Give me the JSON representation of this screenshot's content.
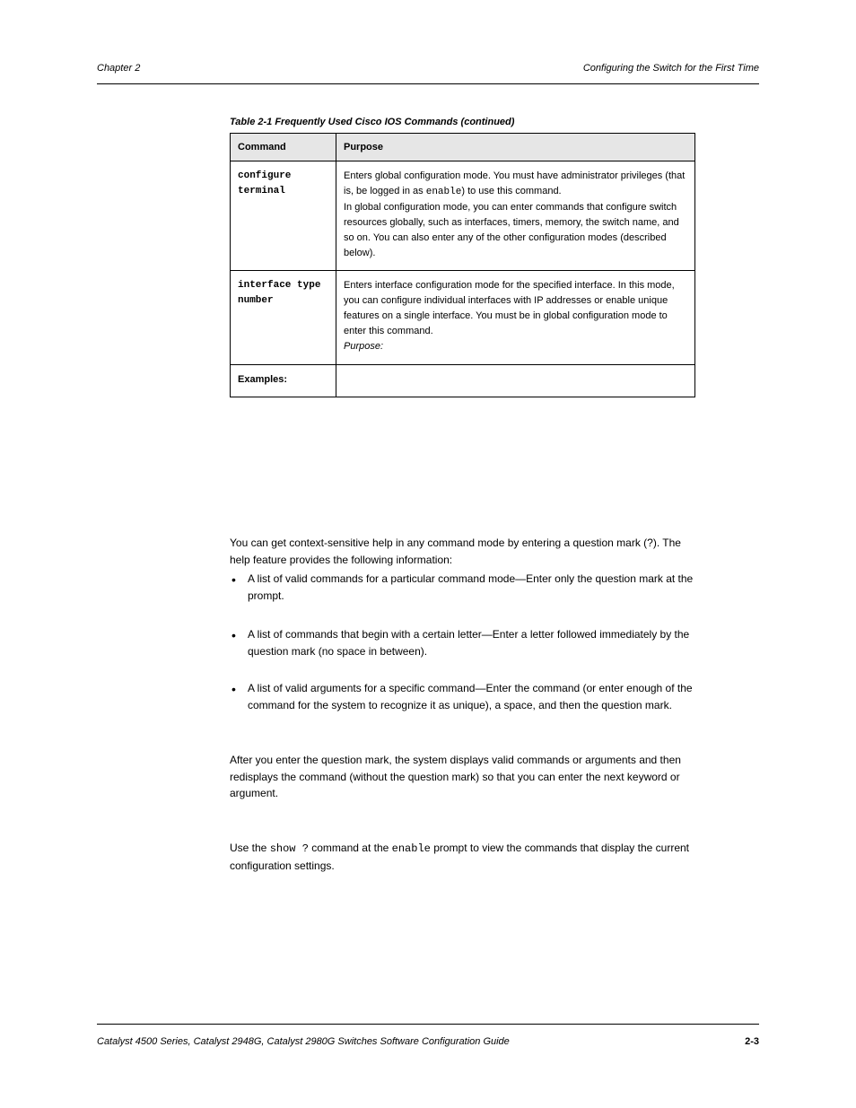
{
  "header": {
    "left": "Chapter 2",
    "right": "Configuring the Switch for the First Time"
  },
  "table": {
    "caption": "Table 2-1   Frequently Used Cisco IOS Commands (continued)",
    "headers": [
      "Command",
      "Purpose"
    ],
    "rows": [
      {
        "label": "configure terminal",
        "desc_html": "Enters global configuration mode. You must have administrator privileges (that is, be logged in as <span class='mono-inline'>enable</span>) to use this command.<br>In global configuration mode, you can enter commands that configure switch resources globally, such as interfaces, timers, memory, the switch name, and so on. You can also enter any of the other configuration modes (described below)."
      },
      {
        "label": "interface type number",
        "desc_html": "Enters interface configuration mode for the specified interface. In this mode, you can configure individual interfaces with IP addresses or enable unique features on a single interface. You must be in global configuration mode to enter this command.<br><span style='font-style:italic'>Purpose:</span>"
      },
      {
        "label": "Examples:",
        "desc_html": ""
      }
    ]
  },
  "body": {
    "p1": "You can get context-sensitive help in any command mode by entering a question mark (?). The help feature provides the following information:",
    "b1": "A list of valid commands for a particular command mode—Enter only the question mark at the prompt.",
    "b2": "A list of commands that begin with a certain letter—Enter a letter followed immediately by the question mark (no space in between).",
    "b3": "A list of valid arguments for a specific command—Enter the command (or enter enough of the command for the system to recognize it as unique), a space, and then the question mark.",
    "p2": "After you enter the question mark, the system displays valid commands or arguments and then redisplays the command (without the question mark) so that you can enter the next keyword or argument.",
    "p3_html": "Use the <span class='mono-inline'>show ?</span> command at the <span class='mono-inline'>enable</span> prompt to view the commands that display the current configuration settings."
  },
  "footer": {
    "left": "Catalyst 4500 Series, Catalyst 2948G, Catalyst 2980G Switches Software Configuration Guide",
    "right": "2-3"
  }
}
